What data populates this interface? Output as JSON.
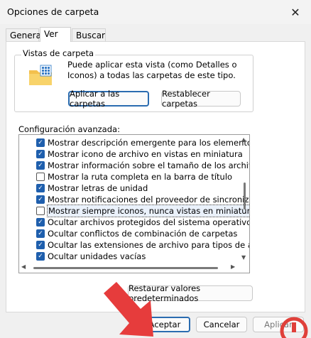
{
  "window": {
    "title": "Opciones de carpeta",
    "close_label": "✕"
  },
  "tabs": [
    {
      "label": "General"
    },
    {
      "label": "Ver"
    },
    {
      "label": "Buscar"
    }
  ],
  "folder_views": {
    "title": "Vistas de carpeta",
    "description": "Puede aplicar esta vista (como Detalles o Iconos) a todas las carpetas de este tipo.",
    "apply_label": "Aplicar a las carpetas",
    "reset_label": "Restablecer carpetas"
  },
  "advanced": {
    "title": "Configuración avanzada:",
    "items": [
      {
        "label": "Mostrar descripción emergente para los elementos de car",
        "checked": true
      },
      {
        "label": "Mostrar icono de archivo en vistas en miniatura",
        "checked": true
      },
      {
        "label": "Mostrar información sobre el tamaño de los archivos en su",
        "checked": true
      },
      {
        "label": "Mostrar la ruta completa en la barra de título",
        "checked": false
      },
      {
        "label": "Mostrar letras de unidad",
        "checked": true
      },
      {
        "label": "Mostrar notificaciones del proveedor de sincronización",
        "checked": true
      },
      {
        "label": "Mostrar siempre iconos, nunca vistas en miniatura",
        "checked": false,
        "selected": true
      },
      {
        "label": "Ocultar archivos protegidos del sistema operativo (recome",
        "checked": true
      },
      {
        "label": "Ocultar conflictos de combinación de carpetas",
        "checked": true
      },
      {
        "label": "Ocultar las extensiones de archivo para tipos de archivo c",
        "checked": true
      },
      {
        "label": "Ocultar unidades vacías",
        "checked": true
      }
    ],
    "restore_label": "Restaurar valores predeterminados"
  },
  "footer": {
    "accept_label": "Aceptar",
    "cancel_label": "Cancelar",
    "apply_label": "Aplicar"
  },
  "colors": {
    "checkbox_checked": "#1f5fad",
    "annotation_arrow": "#e63c3c",
    "watermark": "#e0403a"
  },
  "icons": {
    "folder": "folder-grid-icon",
    "close": "close-icon"
  }
}
